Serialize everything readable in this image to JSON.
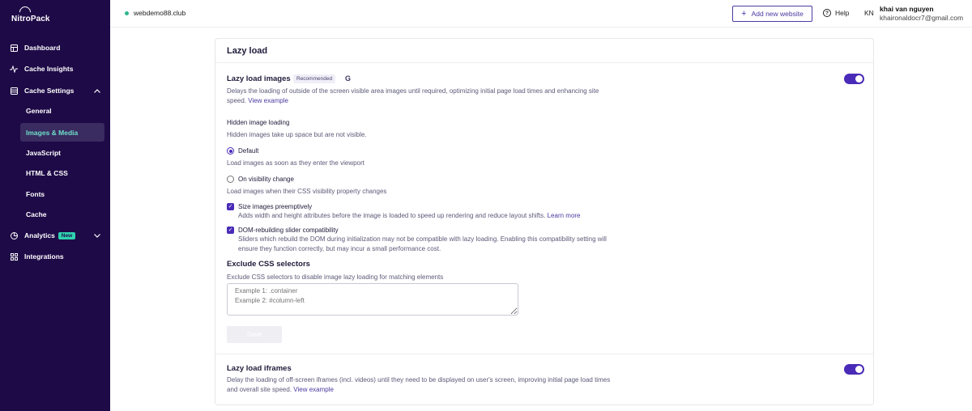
{
  "brand": {
    "name": "NitroPack"
  },
  "sidebar": {
    "items": [
      {
        "label": "Dashboard",
        "icon": "dashboard-icon"
      },
      {
        "label": "Cache Insights",
        "icon": "activity-icon"
      },
      {
        "label": "Cache Settings",
        "icon": "database-icon"
      },
      {
        "label": "Analytics",
        "icon": "chart-pie-icon",
        "badge": "New"
      },
      {
        "label": "Integrations",
        "icon": "grid-icon"
      }
    ],
    "sub_items": [
      "General",
      "Images & Media",
      "JavaScript",
      "HTML & CSS",
      "Fonts",
      "Cache"
    ],
    "active_sub_item": "Images & Media"
  },
  "header": {
    "site": "webdemo88.club",
    "add_website": "Add new website",
    "help": "Help",
    "avatar": "KN",
    "user_name": "khai van nguyen",
    "user_email": "khaironaldocr7@gmail.com"
  },
  "card": {
    "title": "Lazy load",
    "lazy_images": {
      "title": "Lazy load images",
      "badge": "Recommended",
      "g_icon": "G",
      "desc_line1": "Delays the loading of outside of the screen visible area images until required, optimizing initial page load times and enhancing site",
      "desc_line2": "speed.",
      "link": "View example",
      "enabled": true
    },
    "hidden_loading": {
      "title": "Hidden image loading",
      "desc": "Hidden images take up space but are not visible.",
      "options": [
        {
          "label": "Default",
          "desc": "Load images as soon as they enter the viewport",
          "selected": true
        },
        {
          "label": "On visibility change",
          "desc": "Load images when their CSS visibility property changes",
          "selected": false
        }
      ]
    },
    "size_preemptive": {
      "label": "Size images preemptively",
      "desc": "Adds width and height attributes before the image is loaded to speed up rendering and reduce layout shifts.",
      "link": "Learn more",
      "checked": true
    },
    "dom_slider": {
      "label": "DOM-rebuilding slider compatibility",
      "desc_line1": "Sliders which rebuild the DOM during initialization may not be compatible with lazy loading. Enabling this compatibility setting will",
      "desc_line2": "ensure they function correctly, but may incur a small performance cost.",
      "checked": true
    },
    "exclude_css": {
      "title": "Exclude CSS selectors",
      "desc": "Exclude CSS selectors to disable image lazy loading for matching elements",
      "placeholder": "Example 1: .container\nExample 2: #column-left",
      "save": "Save"
    },
    "lazy_iframes": {
      "title": "Lazy load iframes",
      "desc_line1": "Delay the loading of off-screen iframes (incl. videos) until they need to be displayed on user's screen, improving initial page load times",
      "desc_line2": "and overall site speed.",
      "link": "View example",
      "enabled": true
    }
  },
  "colors": {
    "sidebar_bg": "#1e0a47",
    "accent": "#4a2bb8",
    "active_text": "#6ee0c9",
    "badge": "#2fd1b0"
  }
}
